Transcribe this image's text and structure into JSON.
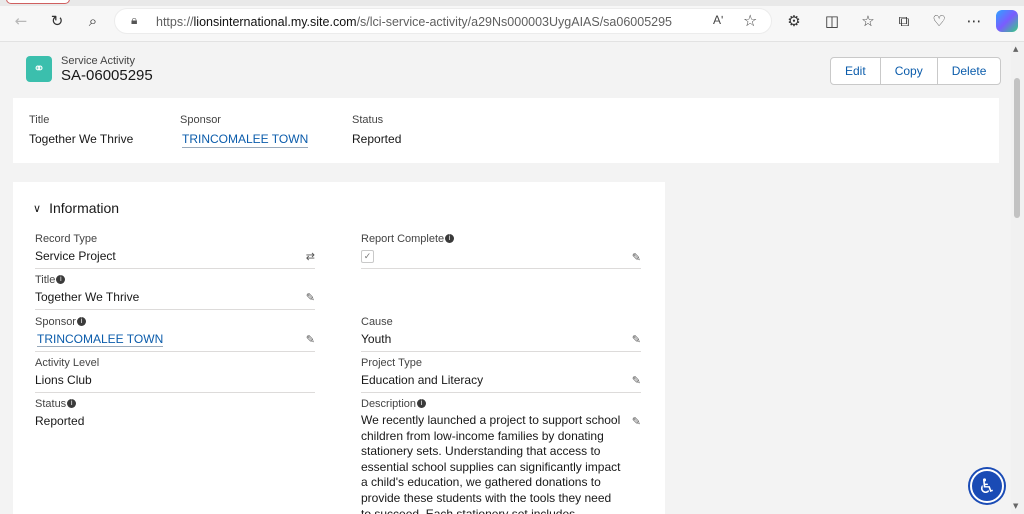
{
  "browser": {
    "url_prefix": "https://",
    "url_host": "lionsinternational.my.site.com",
    "url_path": "/s/lci-service-activity/a29Ns000003UygAIAS/sa06005295",
    "read_aloud": "Aʹ"
  },
  "record": {
    "type": "Service Activity",
    "number": "SA-06005295",
    "actions": [
      "Edit",
      "Copy",
      "Delete"
    ]
  },
  "highlights": [
    {
      "label": "Title",
      "value": "Together We Thrive",
      "link": false
    },
    {
      "label": "Sponsor",
      "value": "TRINCOMALEE TOWN",
      "link": true
    },
    {
      "label": "Status",
      "value": "Reported",
      "link": false
    }
  ],
  "information": {
    "heading": "Information",
    "record_type": {
      "label": "Record Type",
      "value": "Service Project"
    },
    "report_complete": {
      "label": "Report Complete",
      "checked": true
    },
    "title": {
      "label": "Title",
      "value": "Together We Thrive"
    },
    "sponsor": {
      "label": "Sponsor",
      "value": "TRINCOMALEE TOWN"
    },
    "cause": {
      "label": "Cause",
      "value": "Youth"
    },
    "activity_level": {
      "label": "Activity Level",
      "value": "Lions Club"
    },
    "project_type": {
      "label": "Project Type",
      "value": "Education and Literacy"
    },
    "status": {
      "label": "Status",
      "value": "Reported"
    },
    "description": {
      "label": "Description",
      "value": "We recently launched a project to support school children from low-income families by donating stationery sets. Understanding that access to essential school supplies can significantly impact a child's education, we gathered donations to provide these students with the tools they need to succeed. Each stationery set includes notebooks, pens, pencils, and"
    }
  }
}
